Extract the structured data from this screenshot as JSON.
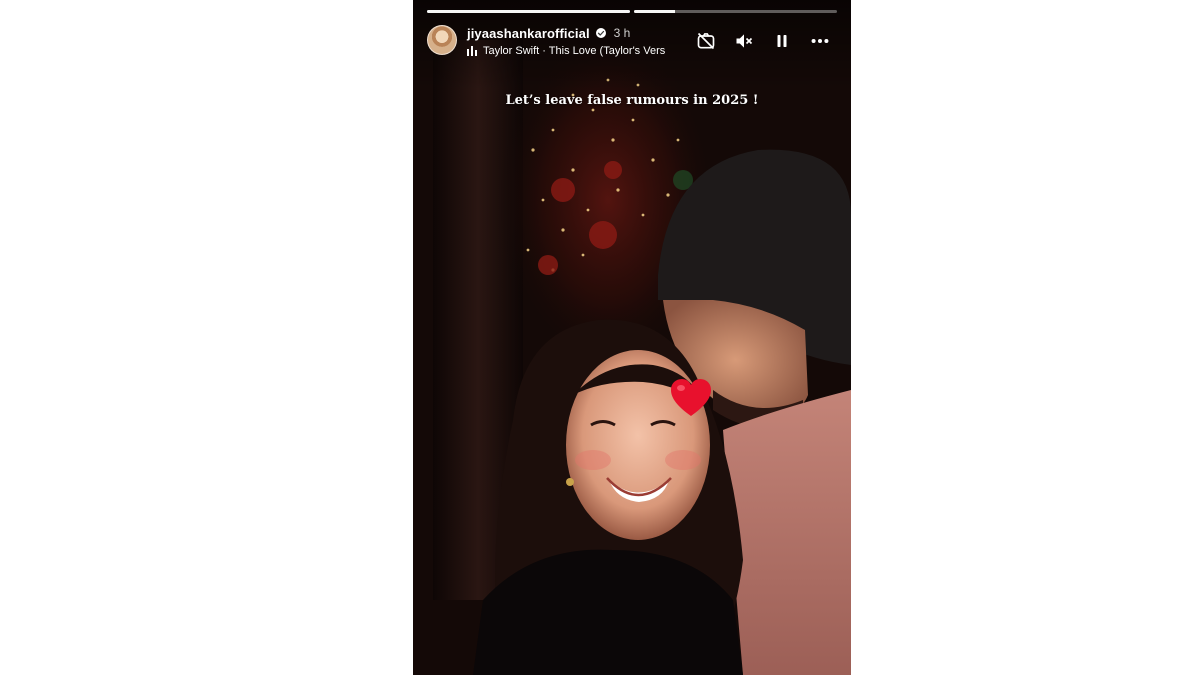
{
  "story": {
    "username": "jiyaashankarofficial",
    "time": "3 h",
    "music": "Taylor Swift · This Love (Taylor's Vers",
    "caption": "Let’s leave false rumours in 2025 !",
    "progress": [
      1.0,
      0.2
    ],
    "sticker": "heart-emoji",
    "icons": {
      "camera_off": "camera-off-icon",
      "mute": "speaker-muted-icon",
      "pause": "pause-icon",
      "more": "more-dots-icon",
      "verified": "verified-badge-icon",
      "music": "music-bars-icon"
    },
    "colors": {
      "sticker_red": "#e8112d",
      "text": "#ffffff"
    }
  }
}
